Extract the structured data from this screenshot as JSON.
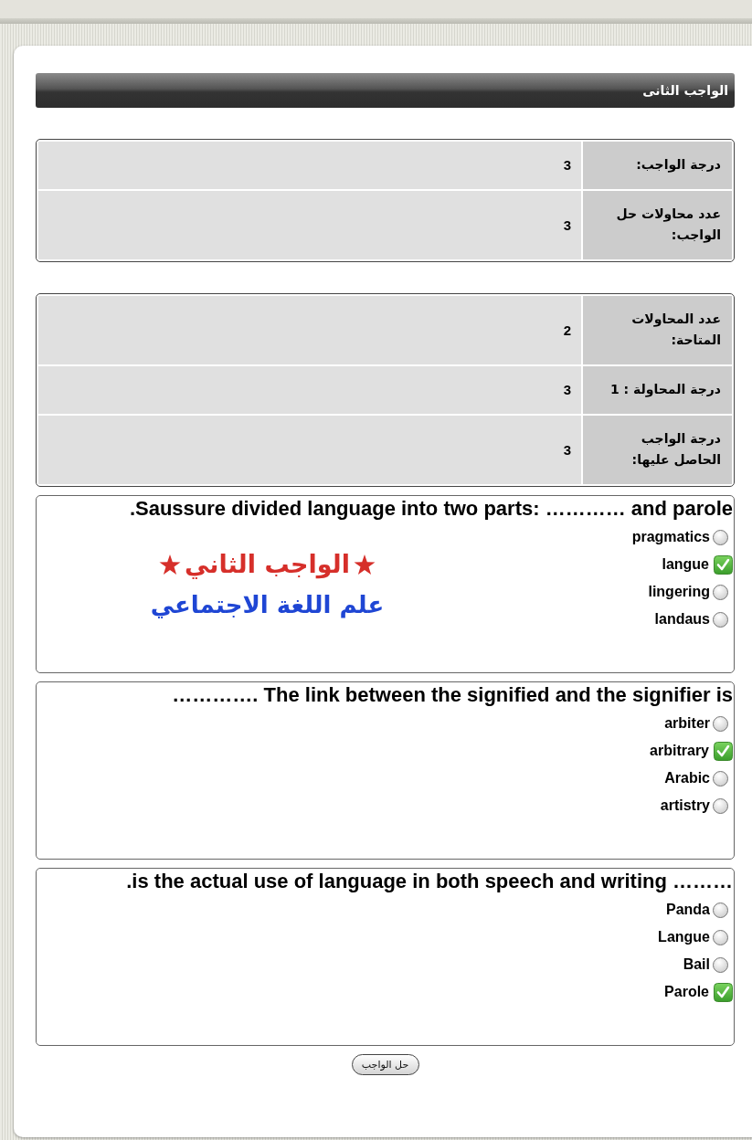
{
  "header": {
    "title": "الواجب الثانى"
  },
  "info_tables": [
    {
      "rows": [
        {
          "label": "درجة الواجب:",
          "value": "3"
        },
        {
          "label": "عدد محاولات حل الواجب:",
          "value": "3"
        }
      ]
    },
    {
      "rows": [
        {
          "label": "عدد المحاولات المتاحة:",
          "value": "2"
        },
        {
          "label": "درجة المحاولة : 1",
          "value": "3"
        },
        {
          "label": "درجة الواجب الحاصل عليها:",
          "value": "3"
        }
      ]
    }
  ],
  "questions": [
    {
      "text": ".Saussure divided language into two parts: ………… and parole",
      "banner": {
        "line_1": "الواجب الثاني",
        "line_2": "علم اللغة الاجتماعي"
      },
      "options": [
        {
          "label": "pragmatics",
          "selected": false
        },
        {
          "label": "langue",
          "selected": true
        },
        {
          "label": "lingering",
          "selected": false
        },
        {
          "label": "landaus",
          "selected": false
        }
      ]
    },
    {
      "text": "…………. The link between the signified and the signifier is",
      "options": [
        {
          "label": "arbiter",
          "selected": false
        },
        {
          "label": "arbitrary",
          "selected": true
        },
        {
          "label": "Arabic",
          "selected": false
        },
        {
          "label": "artistry",
          "selected": false
        }
      ]
    },
    {
      "text": ".is the actual use of language in both speech and writing ………",
      "options": [
        {
          "label": "Panda",
          "selected": false
        },
        {
          "label": "Langue",
          "selected": false
        },
        {
          "label": "Bail",
          "selected": false
        },
        {
          "label": "Parole",
          "selected": true
        }
      ]
    }
  ],
  "submit_button": {
    "label": "حل الواجب"
  }
}
